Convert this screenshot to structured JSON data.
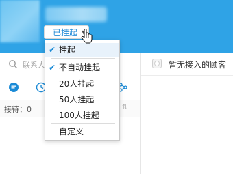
{
  "colors": {
    "header_blue": "#2fa3e6",
    "accent": "#1a8ad6",
    "status_text": "#2b8fd8"
  },
  "header": {
    "status": {
      "label": "已挂起",
      "icon": "chevron-down-icon"
    }
  },
  "status_menu": {
    "items": [
      {
        "label": "挂起",
        "checked": true
      },
      {
        "label": "不自动挂起",
        "checked": true
      },
      {
        "label": "20人挂起",
        "checked": false
      },
      {
        "label": "50人挂起",
        "checked": false
      },
      {
        "label": "100人挂起",
        "checked": false
      },
      {
        "label": "自定义",
        "checked": false
      }
    ]
  },
  "left_panel": {
    "search": {
      "text": "联系人",
      "icon": "search-icon"
    },
    "tabs": [
      {
        "icon": "chat-icon",
        "active": true
      },
      {
        "icon": "clock-icon",
        "active": false
      },
      {
        "icon": "org-icon",
        "active": false
      }
    ],
    "reception": {
      "label": "接待：0",
      "sort_icon": "sort-icon"
    }
  },
  "right_panel": {
    "toggle_label": "暂无接入的顾客"
  }
}
